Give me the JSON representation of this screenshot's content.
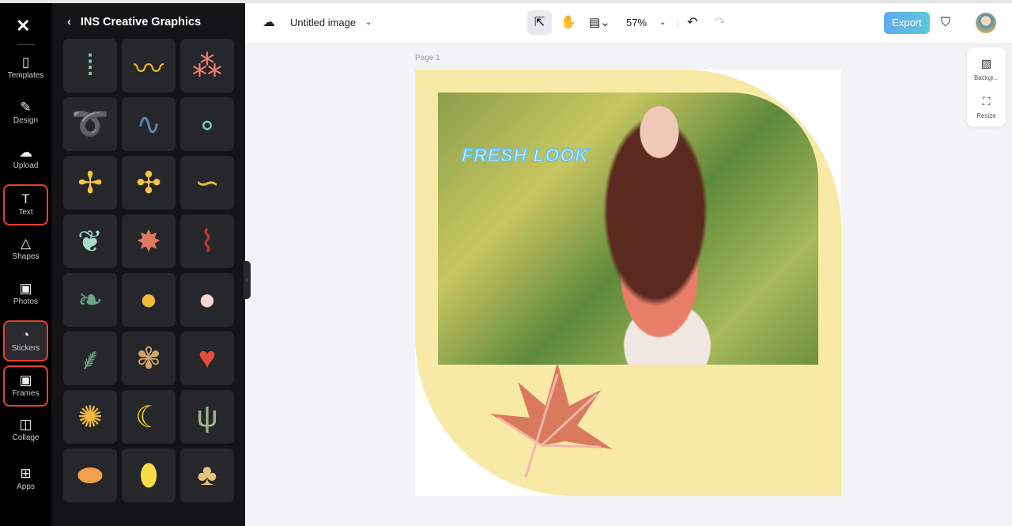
{
  "rail": {
    "logo": "CapCut",
    "items": [
      {
        "label": "Templates",
        "icon": "templates-icon",
        "glyph": "▯"
      },
      {
        "label": "Design",
        "icon": "design-icon",
        "glyph": "✎"
      },
      {
        "label": "Upload",
        "icon": "upload-icon",
        "glyph": "☁"
      },
      {
        "label": "Text",
        "icon": "text-icon",
        "glyph": "T"
      },
      {
        "label": "Shapes",
        "icon": "shapes-icon",
        "glyph": "△"
      },
      {
        "label": "Photos",
        "icon": "photos-icon",
        "glyph": "▣"
      },
      {
        "label": "Stickers",
        "icon": "stickers-icon",
        "glyph": "◔"
      },
      {
        "label": "Frames",
        "icon": "frames-icon",
        "glyph": "▣"
      },
      {
        "label": "Collage",
        "icon": "collage-icon",
        "glyph": "◫"
      },
      {
        "label": "Apps",
        "icon": "apps-icon",
        "glyph": "⊞"
      }
    ],
    "highlight_color": "#e8412c"
  },
  "panel": {
    "title": "INS Creative Graphics",
    "back": "‹",
    "stickers": [
      {
        "name": "green-dashes",
        "glyph": "⁞",
        "color": "#8fc99a"
      },
      {
        "name": "yellow-zigzag",
        "glyph": "〰",
        "color": "#f0b429"
      },
      {
        "name": "pink-crosses",
        "glyph": "⁂",
        "color": "#f0826c"
      },
      {
        "name": "green-curl",
        "glyph": "➰",
        "color": "#7fbf85"
      },
      {
        "name": "blue-squiggle",
        "glyph": "∿",
        "color": "#5d82b0"
      },
      {
        "name": "teal-circles",
        "glyph": "∘",
        "color": "#7cc4c0"
      },
      {
        "name": "yellow-sparkles",
        "glyph": "✢",
        "color": "#f5c542"
      },
      {
        "name": "yellow-plus-cluster",
        "glyph": "✣",
        "color": "#f5c542"
      },
      {
        "name": "yellow-wave",
        "glyph": "∽",
        "color": "#e8b838"
      },
      {
        "name": "monstera-leaf",
        "glyph": "❦",
        "color": "#a9dcc8"
      },
      {
        "name": "orange-maple-leaf",
        "glyph": "✸",
        "color": "#e07a5f"
      },
      {
        "name": "red-thread",
        "glyph": "⌇",
        "color": "#c0392b"
      },
      {
        "name": "green-leaf",
        "glyph": "❧",
        "color": "#6aa77e"
      },
      {
        "name": "passion-fruit",
        "glyph": "●",
        "color": "#f2b83a"
      },
      {
        "name": "peach-slice",
        "glyph": "●",
        "color": "#f7d6cf"
      },
      {
        "name": "fern-sprig",
        "glyph": "⸙",
        "color": "#6aa77e"
      },
      {
        "name": "brown-leaf",
        "glyph": "✾",
        "color": "#d2a36a"
      },
      {
        "name": "strawberry",
        "glyph": "♥",
        "color": "#e74c3c"
      },
      {
        "name": "orange-slice",
        "glyph": "✺",
        "color": "#f6b93b"
      },
      {
        "name": "banana",
        "glyph": "☾",
        "color": "#f9d71c"
      },
      {
        "name": "green-grass",
        "glyph": "ψ",
        "color": "#9bb88a"
      },
      {
        "name": "papaya",
        "glyph": "⬬",
        "color": "#f0a04b"
      },
      {
        "name": "lemon",
        "glyph": "⬮",
        "color": "#f7dc45"
      },
      {
        "name": "ginkgo-leaf",
        "glyph": "♣",
        "color": "#e8c27a"
      }
    ]
  },
  "topbar": {
    "title": "Untitled image",
    "zoom": "57%",
    "export": "Export"
  },
  "canvas": {
    "page_label": "Page 1",
    "headline": "FRESH LOOK"
  },
  "right_panel": {
    "background": "Backgr...",
    "resize": "Resize"
  }
}
